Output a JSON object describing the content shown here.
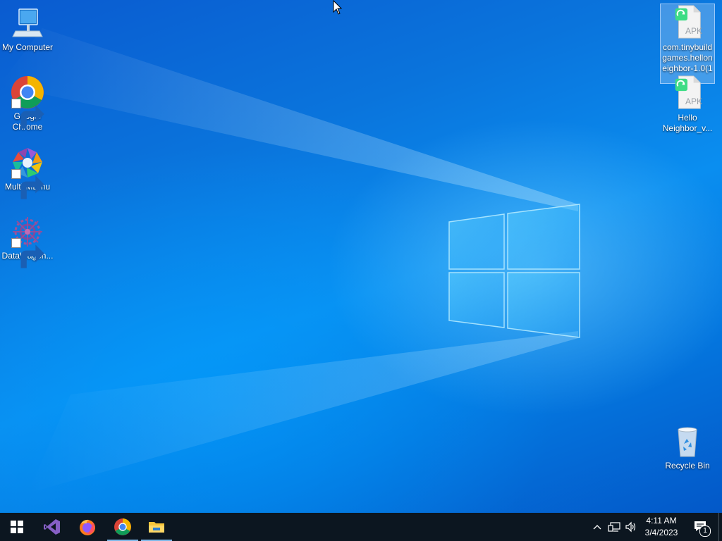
{
  "desktop": {
    "icons_left": [
      {
        "label_line1": "My Computer",
        "label_line2": "",
        "icon": "computer-icon",
        "shortcut": false
      },
      {
        "label_line1": "Google",
        "label_line2": "Chrome",
        "icon": "chrome-icon",
        "shortcut": true
      },
      {
        "label_line1": "Multi-MEmu",
        "label_line2": "",
        "icon": "memu-icon",
        "shortcut": true
      },
      {
        "label_line1": "DataWagon...",
        "label_line2": "",
        "icon": "datawagon-icon",
        "shortcut": true
      }
    ],
    "icons_right": [
      {
        "badge": "APK",
        "label_line1": "com.tinybuild",
        "label_line2": "games.hellon",
        "label_line3": "eighbor-1.0(1",
        "icon": "apk-file-icon",
        "selected": true
      },
      {
        "badge": "APK",
        "label_line1": "Hello",
        "label_line2": "Neighbor_v...",
        "icon": "apk-file-icon",
        "selected": false
      },
      {
        "label_line1": "Recycle Bin",
        "icon": "recycle-bin-icon"
      }
    ]
  },
  "taskbar": {
    "pinned": [
      {
        "name": "start-button",
        "icon": "windows-logo-icon"
      },
      {
        "name": "visual-studio",
        "icon": "visual-studio-icon"
      },
      {
        "name": "firefox",
        "icon": "firefox-icon"
      },
      {
        "name": "chrome",
        "icon": "chrome-icon"
      },
      {
        "name": "file-explorer",
        "icon": "folder-icon"
      }
    ],
    "tray": {
      "time": "4:11 AM",
      "date": "3/4/2023",
      "notification_count": "1"
    }
  },
  "colors": {
    "taskbar_bg": "#0c1620",
    "desktop_blue": "#0a8ef0"
  }
}
